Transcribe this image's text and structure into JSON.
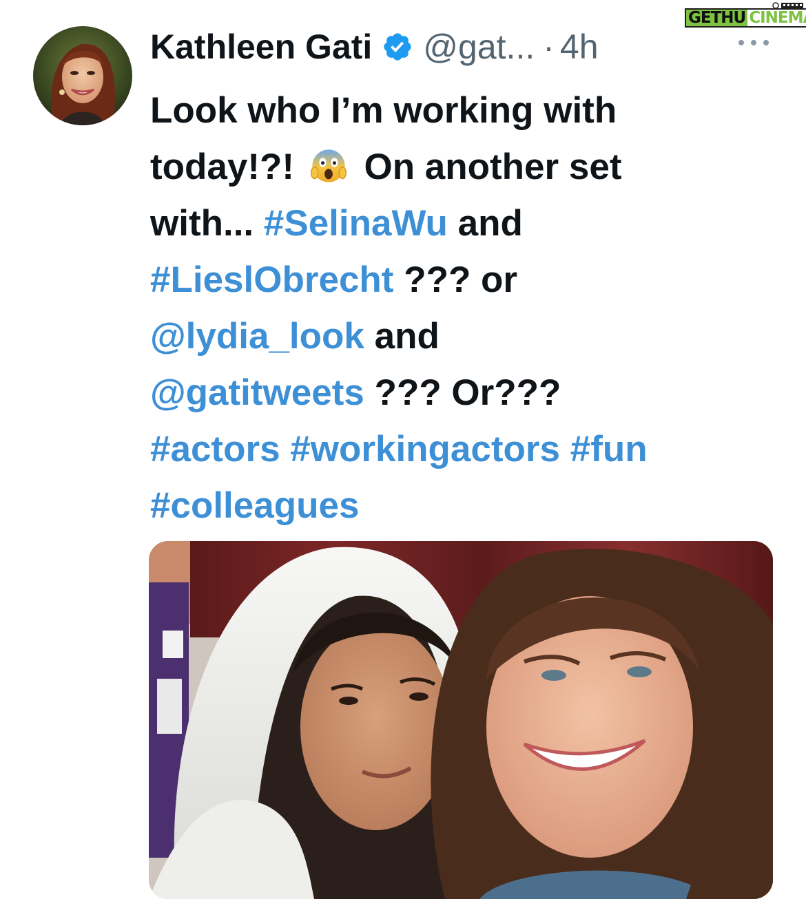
{
  "watermark": {
    "part1": "GETHU",
    "part2": "CINEMA"
  },
  "author": {
    "name": "Kathleen Gati",
    "handle": "@gat...",
    "separator": "·",
    "time": "4h",
    "verified": true
  },
  "icons": {
    "verified": "verified-badge-icon",
    "more": "more-horizontal-icon",
    "emoji": "face-screaming-in-fear-emoji"
  },
  "tweet": {
    "lines": [
      [
        {
          "t": "Look who I’m working with",
          "link": false
        }
      ],
      [
        {
          "t": "today!?! ",
          "link": false
        },
        {
          "emoji": true
        },
        {
          "t": " On another set",
          "link": false
        }
      ],
      [
        {
          "t": "with... ",
          "link": false
        },
        {
          "t": "#SelinaWu",
          "link": true
        },
        {
          "t": " and",
          "link": false
        }
      ],
      [
        {
          "t": "#LieslObrecht",
          "link": true
        },
        {
          "t": " ??? or",
          "link": false
        }
      ],
      [
        {
          "t": "@lydia_look",
          "link": true
        },
        {
          "t": " and",
          "link": false
        }
      ],
      [
        {
          "t": "@gatitweets",
          "link": true
        },
        {
          "t": " ??? Or???",
          "link": false
        }
      ],
      [
        {
          "t": "#actors #workingactors #fun",
          "link": true
        }
      ],
      [
        {
          "t": "#colleagues",
          "link": true
        }
      ]
    ]
  },
  "colors": {
    "text": "#0f1419",
    "muted": "#536471",
    "link": "#3d8fd6",
    "verified": "#1d9bf0",
    "watermark_green": "#7ec242"
  }
}
